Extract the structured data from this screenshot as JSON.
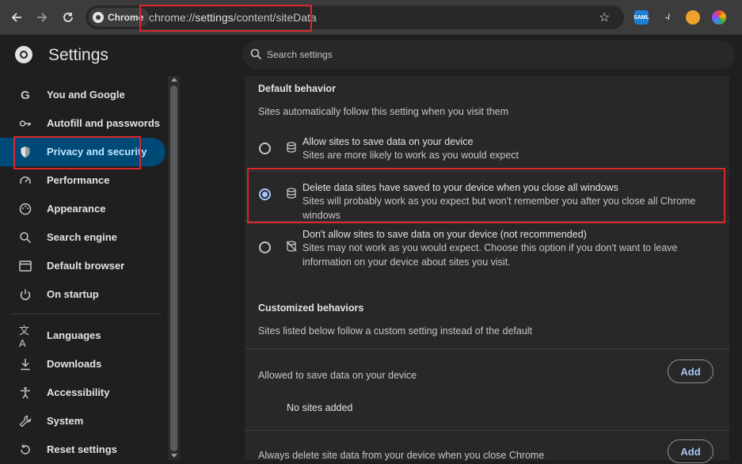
{
  "browser": {
    "chip_label": "Chrome",
    "url_scheme": "chrome://",
    "url_host": "settings",
    "url_path": "/content/siteData",
    "extensions": [
      "SAML",
      "-/",
      "",
      ""
    ]
  },
  "header": {
    "title": "Settings",
    "search_placeholder": "Search settings"
  },
  "sidebar": {
    "items": [
      {
        "label": "You and Google",
        "icon": "google-icon"
      },
      {
        "label": "Autofill and passwords",
        "icon": "key-icon"
      },
      {
        "label": "Privacy and security",
        "icon": "shield-icon",
        "active": true
      },
      {
        "label": "Performance",
        "icon": "gauge-icon"
      },
      {
        "label": "Appearance",
        "icon": "palette-icon"
      },
      {
        "label": "Search engine",
        "icon": "search-icon"
      },
      {
        "label": "Default browser",
        "icon": "browser-window-icon"
      },
      {
        "label": "On startup",
        "icon": "power-icon"
      },
      {
        "label": "Languages",
        "icon": "translate-icon"
      },
      {
        "label": "Downloads",
        "icon": "download-icon"
      },
      {
        "label": "Accessibility",
        "icon": "accessibility-icon"
      },
      {
        "label": "System",
        "icon": "wrench-icon"
      },
      {
        "label": "Reset settings",
        "icon": "reset-icon"
      }
    ]
  },
  "main": {
    "default_behavior": {
      "title": "Default behavior",
      "description": "Sites automatically follow this setting when you visit them",
      "options": [
        {
          "label": "Allow sites to save data on your device",
          "sub": "Sites are more likely to work as you would expect",
          "selected": false
        },
        {
          "label": "Delete data sites have saved to your device when you close all windows",
          "sub": "Sites will probably work as you expect but won't remember you after you close all Chrome windows",
          "selected": true
        },
        {
          "label": "Don't allow sites to save data on your device (not recommended)",
          "sub": "Sites may not work as you would expect. Choose this option if you don't want to leave information on your device about sites you visit.",
          "selected": false
        }
      ]
    },
    "customized": {
      "title": "Customized behaviors",
      "description": "Sites listed below follow a custom setting instead of the default",
      "allowed_label": "Allowed to save data on your device",
      "add_label": "Add",
      "empty_label": "No sites added",
      "always_delete_label": "Always delete site data from your device when you close Chrome"
    }
  },
  "colors": {
    "accent": "#a8c7fa",
    "active_nav_bg": "#004a77",
    "highlight_border": "#d9272e"
  }
}
